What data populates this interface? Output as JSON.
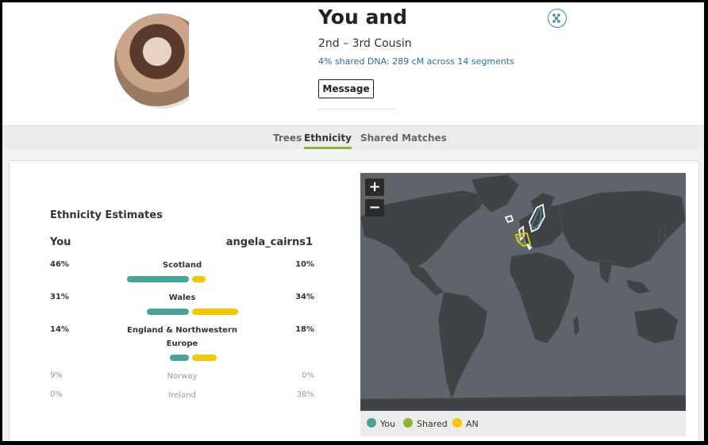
{
  "header": {
    "title": "You and",
    "relationship": "2nd – 3rd Cousin",
    "dna_summary": "4% shared DNA: 289 cM across 14 segments",
    "message_label": "Message",
    "tree_icon": "tree-link-icon"
  },
  "tabs": [
    {
      "label": "Trees",
      "active": false
    },
    {
      "label": "Ethnicity",
      "active": true
    },
    {
      "label": "Shared Matches",
      "active": false
    }
  ],
  "ethnicity": {
    "title": "Ethnicity Estimates",
    "you_label": "You",
    "match_label": "angela_cairns1",
    "colors": {
      "you": "#4aa39b",
      "match": "#f6c700",
      "shared": "#8ab53a"
    },
    "regions": [
      {
        "name": "Scotland",
        "you": "46%",
        "match": "10%",
        "you_pct": 46,
        "match_pct": 10,
        "highlight": true
      },
      {
        "name": "Wales",
        "you": "31%",
        "match": "34%",
        "you_pct": 31,
        "match_pct": 34,
        "highlight": true
      },
      {
        "name": "England & Northwestern Europe",
        "you": "14%",
        "match": "18%",
        "you_pct": 14,
        "match_pct": 18,
        "highlight": true
      },
      {
        "name": "Norway",
        "you": "9%",
        "match": "0%",
        "you_pct": 9,
        "match_pct": 0,
        "highlight": false
      },
      {
        "name": "Ireland",
        "you": "0%",
        "match": "38%",
        "you_pct": 0,
        "match_pct": 38,
        "highlight": false
      }
    ]
  },
  "map": {
    "zoom_in": "+",
    "zoom_out": "−",
    "legend": [
      {
        "label": "You",
        "color": "#4aa39b"
      },
      {
        "label": "Shared",
        "color": "#8ab53a"
      },
      {
        "label": "AN",
        "color": "#f6c700"
      }
    ]
  }
}
